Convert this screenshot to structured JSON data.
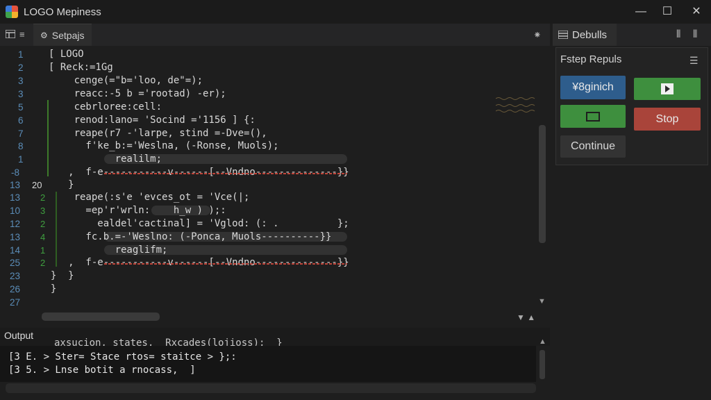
{
  "window": {
    "title": "LOGO Mepiness",
    "minimize": "—",
    "maximize": "☐",
    "close": "✕"
  },
  "left_tabs": {
    "active_tab": "Setpajs",
    "split_icon": "⁕"
  },
  "debug": {
    "tab_label": "Debulls",
    "pin_icon": "⫴",
    "grid_icon": "⫴",
    "panel_title": "Fstep Repuls",
    "menu_icon": "☰",
    "engine_button": "¥8ginich",
    "run_button_icon": "play-icon",
    "window_button_icon": "window-icon",
    "stop_button": "Stop",
    "continue_button": "Continue"
  },
  "editor": {
    "line_numbers": [
      "1",
      "2",
      "3",
      "3",
      "5",
      "6",
      "7",
      "8",
      "1",
      "-8",
      "13",
      "13",
      "10",
      "12",
      "13",
      "14",
      "25",
      "23",
      "26",
      "27"
    ],
    "markers": [
      "",
      "",
      "",
      "",
      "",
      "",
      "",
      "",
      "",
      "",
      "20",
      "2",
      "3",
      "2",
      "4",
      "1",
      "2",
      "",
      "",
      ""
    ],
    "lines": [
      "[ LOGO",
      "[ Reck:=1Gg",
      "      cenge(=\"b='loo, de\"=);",
      "      reacc:-5 b ='rootad) -er);",
      "      cebrloree:cell:",
      "      renod:lano= 'Socind ='1156 ] {:",
      "      reape(r7 -'larpe, stind =-Dve=(),",
      "        f'ke_b:='Weslna, (-Ronse, Muols);",
      "             realilm;",
      "     ,  f-e-----------v------[--Vndno--------------}}",
      "     }",
      "      reape(:s'e 'evces_ot = 'Vce(|;",
      "        =ep'r'wrln:    h_w ) );:",
      "          ealdel'cactinal] = 'Vglod: (: .          };",
      "        fc.b.=-'Weslno: (-Ponca, Muols----------}}",
      "             reaglifm;",
      "     ,  f-e-----------v------[--Vndno--------------}}",
      "  }  }",
      "  }",
      ""
    ]
  },
  "output": {
    "title": "Output",
    "line0": "axsucion, states,  Rxcades(lojioss);  }",
    "line1": "[3 E. > Ster= Stace rtos= staitce > };:",
    "line2": "[3 5. > Lnse botit a rnocass,  ]"
  }
}
